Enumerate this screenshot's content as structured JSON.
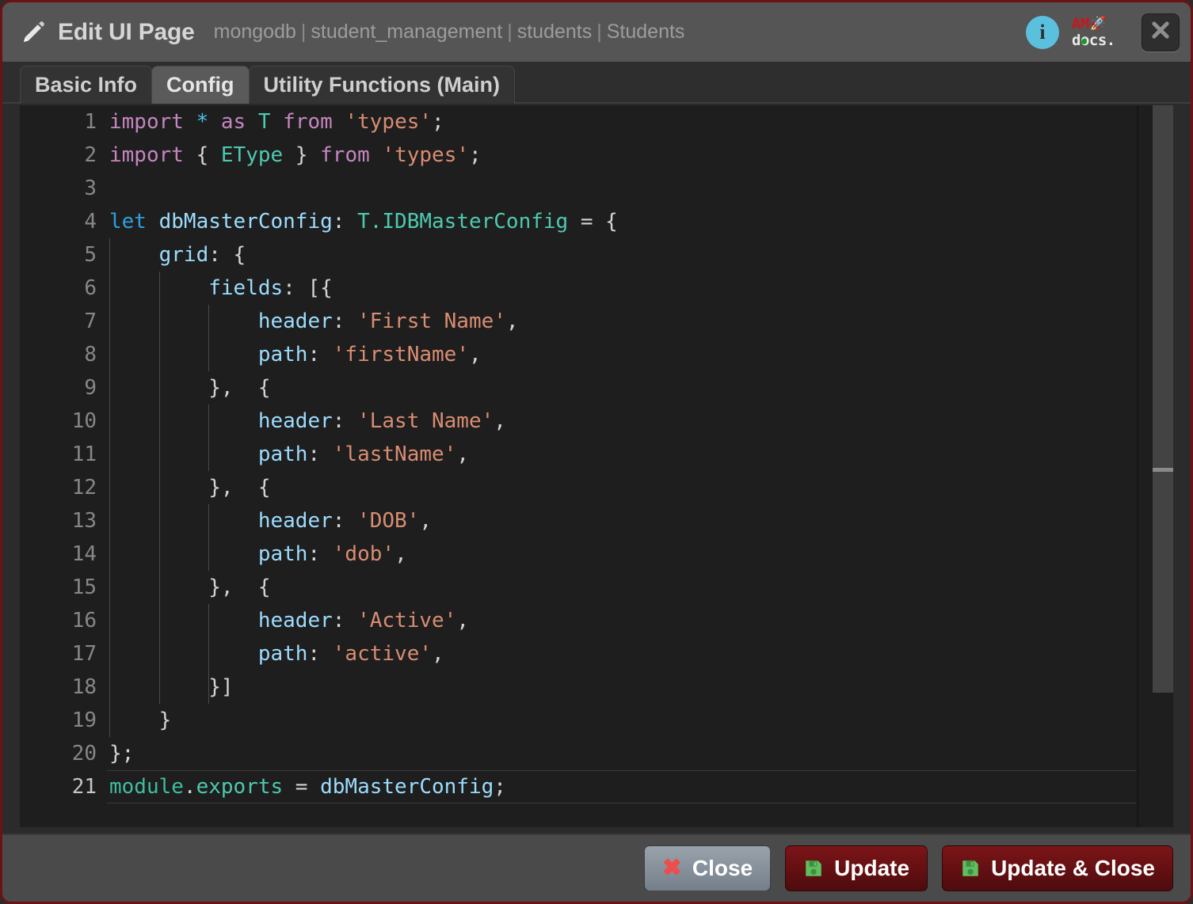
{
  "window": {
    "border_color": "#6b1214"
  },
  "header": {
    "icon": "pencil-icon",
    "title": "Edit UI Page",
    "breadcrumb": [
      "mongodb",
      "student_management",
      "students",
      "Students"
    ],
    "separator": "|",
    "info_icon": "info-icon",
    "info_glyph": "i",
    "logo": {
      "top": "AM",
      "rocket": "🚀",
      "bottom": "docs.",
      "red": "#c9161d",
      "green_dot": "#179a22"
    },
    "close_icon": "close-icon"
  },
  "tabs": [
    {
      "label": "Basic Info",
      "active": false
    },
    {
      "label": "Config",
      "active": true
    },
    {
      "label": "Utility Functions (Main)",
      "active": false
    }
  ],
  "editor": {
    "language": "typescript",
    "active_line": 21,
    "total_lines": 21,
    "lines": [
      {
        "n": "1",
        "guides": 0,
        "tokens": [
          {
            "t": "import",
            "c": "k-kw"
          },
          {
            "t": " ",
            "c": "k-punc"
          },
          {
            "t": "*",
            "c": "k-op"
          },
          {
            "t": " ",
            "c": "k-punc"
          },
          {
            "t": "as",
            "c": "k-kw"
          },
          {
            "t": " ",
            "c": "k-punc"
          },
          {
            "t": "T",
            "c": "k-type"
          },
          {
            "t": " ",
            "c": "k-punc"
          },
          {
            "t": "from",
            "c": "k-kw"
          },
          {
            "t": " ",
            "c": "k-punc"
          },
          {
            "t": "'types'",
            "c": "k-str"
          },
          {
            "t": ";",
            "c": "k-punc"
          }
        ]
      },
      {
        "n": "2",
        "guides": 0,
        "tokens": [
          {
            "t": "import",
            "c": "k-kw"
          },
          {
            "t": " ",
            "c": "k-punc"
          },
          {
            "t": "{ ",
            "c": "k-punc"
          },
          {
            "t": "EType",
            "c": "k-type"
          },
          {
            "t": " }",
            "c": "k-punc"
          },
          {
            "t": " ",
            "c": "k-punc"
          },
          {
            "t": "from",
            "c": "k-kw"
          },
          {
            "t": " ",
            "c": "k-punc"
          },
          {
            "t": "'types'",
            "c": "k-str"
          },
          {
            "t": ";",
            "c": "k-punc"
          }
        ]
      },
      {
        "n": "3",
        "guides": 0,
        "tokens": []
      },
      {
        "n": "4",
        "guides": 0,
        "tokens": [
          {
            "t": "let",
            "c": "k-let"
          },
          {
            "t": " ",
            "c": "k-punc"
          },
          {
            "t": "dbMasterConfig",
            "c": "k-ident"
          },
          {
            "t": ": ",
            "c": "k-punc"
          },
          {
            "t": "T.IDBMasterConfig",
            "c": "k-type"
          },
          {
            "t": " = {",
            "c": "k-punc"
          }
        ]
      },
      {
        "n": "5",
        "guides": 1,
        "tokens": [
          {
            "t": "    ",
            "c": "k-punc"
          },
          {
            "t": "grid",
            "c": "k-ident"
          },
          {
            "t": ": {",
            "c": "k-punc"
          }
        ]
      },
      {
        "n": "6",
        "guides": 2,
        "tokens": [
          {
            "t": "        ",
            "c": "k-punc"
          },
          {
            "t": "fields",
            "c": "k-ident"
          },
          {
            "t": ": [{",
            "c": "k-punc"
          }
        ]
      },
      {
        "n": "7",
        "guides": 3,
        "tokens": [
          {
            "t": "            ",
            "c": "k-punc"
          },
          {
            "t": "header",
            "c": "k-ident"
          },
          {
            "t": ": ",
            "c": "k-punc"
          },
          {
            "t": "'First Name'",
            "c": "k-str"
          },
          {
            "t": ",",
            "c": "k-punc"
          }
        ]
      },
      {
        "n": "8",
        "guides": 3,
        "tokens": [
          {
            "t": "            ",
            "c": "k-punc"
          },
          {
            "t": "path",
            "c": "k-ident"
          },
          {
            "t": ": ",
            "c": "k-punc"
          },
          {
            "t": "'firstName'",
            "c": "k-str"
          },
          {
            "t": ",",
            "c": "k-punc"
          }
        ]
      },
      {
        "n": "9",
        "guides": 2,
        "tokens": [
          {
            "t": "        },  {",
            "c": "k-punc"
          }
        ]
      },
      {
        "n": "10",
        "guides": 3,
        "tokens": [
          {
            "t": "            ",
            "c": "k-punc"
          },
          {
            "t": "header",
            "c": "k-ident"
          },
          {
            "t": ": ",
            "c": "k-punc"
          },
          {
            "t": "'Last Name'",
            "c": "k-str"
          },
          {
            "t": ",",
            "c": "k-punc"
          }
        ]
      },
      {
        "n": "11",
        "guides": 3,
        "tokens": [
          {
            "t": "            ",
            "c": "k-punc"
          },
          {
            "t": "path",
            "c": "k-ident"
          },
          {
            "t": ": ",
            "c": "k-punc"
          },
          {
            "t": "'lastName'",
            "c": "k-str"
          },
          {
            "t": ",",
            "c": "k-punc"
          }
        ]
      },
      {
        "n": "12",
        "guides": 2,
        "tokens": [
          {
            "t": "        },  {",
            "c": "k-punc"
          }
        ]
      },
      {
        "n": "13",
        "guides": 3,
        "tokens": [
          {
            "t": "            ",
            "c": "k-punc"
          },
          {
            "t": "header",
            "c": "k-ident"
          },
          {
            "t": ": ",
            "c": "k-punc"
          },
          {
            "t": "'DOB'",
            "c": "k-str"
          },
          {
            "t": ",",
            "c": "k-punc"
          }
        ]
      },
      {
        "n": "14",
        "guides": 3,
        "tokens": [
          {
            "t": "            ",
            "c": "k-punc"
          },
          {
            "t": "path",
            "c": "k-ident"
          },
          {
            "t": ": ",
            "c": "k-punc"
          },
          {
            "t": "'dob'",
            "c": "k-str"
          },
          {
            "t": ",",
            "c": "k-punc"
          }
        ]
      },
      {
        "n": "15",
        "guides": 2,
        "tokens": [
          {
            "t": "        },  {",
            "c": "k-punc"
          }
        ]
      },
      {
        "n": "16",
        "guides": 3,
        "tokens": [
          {
            "t": "            ",
            "c": "k-punc"
          },
          {
            "t": "header",
            "c": "k-ident"
          },
          {
            "t": ": ",
            "c": "k-punc"
          },
          {
            "t": "'Active'",
            "c": "k-str"
          },
          {
            "t": ",",
            "c": "k-punc"
          }
        ]
      },
      {
        "n": "17",
        "guides": 3,
        "tokens": [
          {
            "t": "            ",
            "c": "k-punc"
          },
          {
            "t": "path",
            "c": "k-ident"
          },
          {
            "t": ": ",
            "c": "k-punc"
          },
          {
            "t": "'active'",
            "c": "k-str"
          },
          {
            "t": ",",
            "c": "k-punc"
          }
        ]
      },
      {
        "n": "18",
        "guides": 3,
        "tokens": [
          {
            "t": "        }]",
            "c": "k-punc"
          }
        ]
      },
      {
        "n": "19",
        "guides": 1,
        "tokens": [
          {
            "t": "    }",
            "c": "k-punc"
          }
        ]
      },
      {
        "n": "20",
        "guides": 0,
        "tokens": [
          {
            "t": "};",
            "c": "k-punc"
          }
        ]
      },
      {
        "n": "21",
        "guides": 0,
        "active": true,
        "tokens": [
          {
            "t": "module",
            "c": "k-green"
          },
          {
            "t": ".",
            "c": "k-punc"
          },
          {
            "t": "exports",
            "c": "k-green2"
          },
          {
            "t": " = ",
            "c": "k-punc"
          },
          {
            "t": "dbMasterConfig",
            "c": "k-ident"
          },
          {
            "t": ";",
            "c": "k-punc"
          }
        ]
      }
    ],
    "scrollbar": {
      "visible": true
    }
  },
  "footer": {
    "buttons": [
      {
        "label": "Close",
        "icon": "cancel-x-icon",
        "style": "close"
      },
      {
        "label": "Update",
        "icon": "save-icon",
        "style": "danger"
      },
      {
        "label": "Update & Close",
        "icon": "save-icon",
        "style": "danger"
      }
    ]
  }
}
